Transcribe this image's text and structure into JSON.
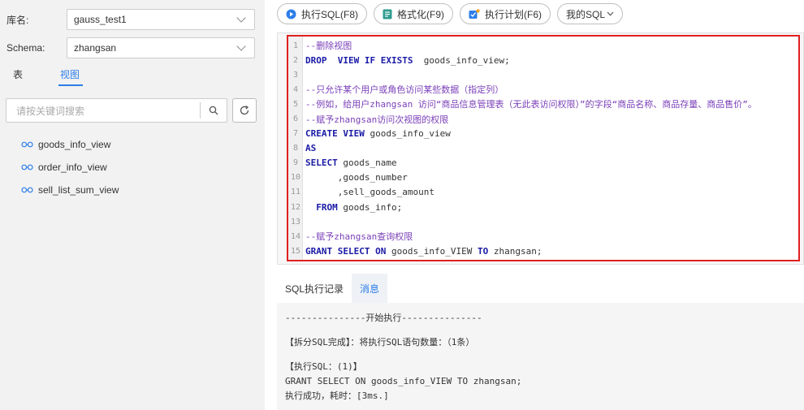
{
  "left": {
    "db_label": "库名:",
    "db_value": "gauss_test1",
    "schema_label": "Schema:",
    "schema_value": "zhangsan",
    "tabs": [
      {
        "label": "表"
      },
      {
        "label": "视图"
      }
    ],
    "search_placeholder": "请按关键词搜索",
    "views": [
      {
        "name": "goods_info_view"
      },
      {
        "name": "order_info_view"
      },
      {
        "name": "sell_list_sum_view"
      }
    ]
  },
  "toolbar": {
    "run_label": "执行SQL(F8)",
    "format_label": "格式化(F9)",
    "plan_label": "执行计划(F6)",
    "my_sql_label": "我的SQL"
  },
  "editor": {
    "lines": [
      {
        "n": "1",
        "text": "--删除视图"
      },
      {
        "n": "2",
        "text": "DROP  VIEW IF EXISTS  goods_info_view;"
      },
      {
        "n": "3",
        "text": ""
      },
      {
        "n": "4",
        "text": "--只允许某个用户或角色访问某些数据（指定列）"
      },
      {
        "n": "5",
        "text": "--例如，给用户zhangsan 访问“商品信息管理表（无此表访问权限）”的字段“商品名称、商品存量、商品售价”。"
      },
      {
        "n": "6",
        "text": "--赋予zhangsan访问次视图的权限"
      },
      {
        "n": "7",
        "text": "CREATE VIEW goods_info_view"
      },
      {
        "n": "8",
        "text": "AS"
      },
      {
        "n": "9",
        "text": "SELECT goods_name"
      },
      {
        "n": "10",
        "text": "      ,goods_number"
      },
      {
        "n": "11",
        "text": "      ,sell_goods_amount"
      },
      {
        "n": "12",
        "text": "  FROM goods_info;"
      },
      {
        "n": "13",
        "text": ""
      },
      {
        "n": "14",
        "text": "--赋予zhangsan查询权限"
      },
      {
        "n": "15",
        "text": "GRANT SELECT ON goods_info_VIEW TO zhangsan;"
      }
    ]
  },
  "bottom": {
    "tabs": [
      {
        "label": "SQL执行记录"
      },
      {
        "label": "消息"
      }
    ],
    "console": {
      "start": "---------------开始执行---------------",
      "split": "【拆分SQL完成】：将执行SQL语句数量：（1条）",
      "exec_header": "【执行SQL：(1)】",
      "exec_sql": "GRANT SELECT ON goods_info_VIEW TO zhangsan;",
      "result": "执行成功，耗时：[3ms.]"
    }
  },
  "colors": {
    "accent": "#2d7ee9",
    "highlight_border": "#e02020"
  }
}
